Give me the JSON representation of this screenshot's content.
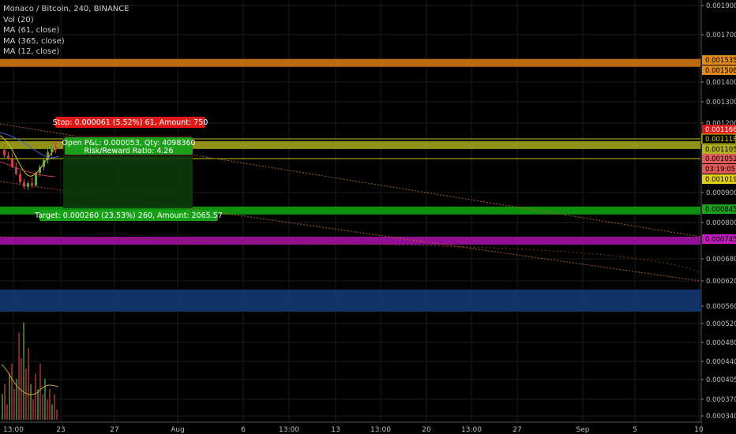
{
  "legend": {
    "symbol": "Monaco / Bitcoin, 240, BINANCE",
    "vol": "Vol (20)",
    "ma61": "MA (61, close)",
    "ma365": "MA (365, close)",
    "ma12": "MA (12, close)"
  },
  "colors": {
    "background": "#000000",
    "grid": "#1c1c1c",
    "orange_zone": "#c8700f",
    "yellow_zone": "#9a9a1a",
    "green_zone": "#0f9a0f",
    "purple_zone": "#9a0f9a",
    "blue_zone": "#12366e",
    "trend_line": "#b05a2a",
    "stop_label": "#e01818",
    "target_label": "#18a018",
    "position_label": "#1ca01c",
    "candle_up": "#5c9e4a",
    "candle_down": "#c24141",
    "volume_up": "#3d6e32",
    "volume_down": "#7a2a2a",
    "ma_yellow": "#d6c21c",
    "ma_blue": "#4466cc",
    "ma_red": "#cc3344",
    "vol_ma": "#c8a040"
  },
  "position_tool": {
    "stop_text": "Stop: 0.000061 (5.52%) 61, Amount: 750",
    "pnl_text": "Open P&L: 0.000053, Qty: 4098360",
    "rr_text": "Risk/Reward Ratio: 4.26",
    "target_text": "Target: 0.000260 (23.53%) 260, Amount: 2065.57"
  },
  "chart_data": {
    "type": "candlestick",
    "title": "Monaco / Bitcoin, 240, BINANCE",
    "y_axis": {
      "ticks": [
        "0.001900",
        "0.001700",
        "0.001400",
        "0.001300",
        "0.001200",
        "0.000900",
        "0.000800",
        "0.000680",
        "0.000620",
        "0.000560",
        "0.000520",
        "0.000480",
        "0.000440",
        "0.000405",
        "0.000370",
        "0.000340"
      ]
    },
    "price_badges": [
      {
        "text": "0.001535",
        "color": "#e08a1c",
        "text_color": "#000"
      },
      {
        "text": "0.001508",
        "color": "#e08a1c",
        "text_color": "#000"
      },
      {
        "text": "0.001166",
        "color": "#e01818",
        "text_color": "#fff"
      },
      {
        "text": "0.001118",
        "color": "#000000",
        "text_color": "#d6d600",
        "border": "#d6d600"
      },
      {
        "text": "0.001105",
        "color": "#b0b020",
        "text_color": "#000"
      },
      {
        "text": "0.001052",
        "color": "#e05a5a",
        "text_color": "#000"
      },
      {
        "text": "03:19:05",
        "color": "#e05a5a",
        "text_color": "#000"
      },
      {
        "text": "0.001019",
        "color": "#e0d01c",
        "text_color": "#000"
      },
      {
        "text": "0.000845",
        "color": "#1ca01c",
        "text_color": "#000"
      },
      {
        "text": "0.000745",
        "color": "#c01cc0",
        "text_color": "#000"
      }
    ],
    "x_axis": {
      "ticks": [
        "13:00",
        "23",
        "27",
        "Aug",
        "6",
        "13:00",
        "13",
        "13:00",
        "20",
        "13:00",
        "27",
        "Sep",
        "5",
        "10"
      ]
    },
    "zones": [
      {
        "name": "resistance-orange",
        "low": 0.001508,
        "high": 0.001535
      },
      {
        "name": "entry-yellow",
        "low": 0.001092,
        "high": 0.001118
      },
      {
        "name": "target-green",
        "low": 0.000835,
        "high": 0.000845
      },
      {
        "name": "support-purple",
        "low": 0.000735,
        "high": 0.000745
      },
      {
        "name": "support-blue",
        "low": 0.000547,
        "high": 0.0006
      }
    ],
    "candles": [
      {
        "o": 0.001085,
        "h": 0.00111,
        "l": 0.00105,
        "c": 0.00106
      },
      {
        "o": 0.00106,
        "h": 0.001075,
        "l": 0.00104,
        "c": 0.001045
      },
      {
        "o": 0.001045,
        "h": 0.00107,
        "l": 0.001005,
        "c": 0.00101
      },
      {
        "o": 0.00101,
        "h": 0.00103,
        "l": 0.000975,
        "c": 0.00098
      },
      {
        "o": 0.00098,
        "h": 0.000995,
        "l": 0.000935,
        "c": 0.000945
      },
      {
        "o": 0.000945,
        "h": 0.00096,
        "l": 0.000915,
        "c": 0.000925
      },
      {
        "o": 0.000925,
        "h": 0.00095,
        "l": 0.00091,
        "c": 0.00094
      },
      {
        "o": 0.00094,
        "h": 0.000965,
        "l": 0.00092,
        "c": 0.00093
      },
      {
        "o": 0.00093,
        "h": 0.00099,
        "l": 0.000925,
        "c": 0.000985
      },
      {
        "o": 0.000985,
        "h": 0.00102,
        "l": 0.00097,
        "c": 0.00101
      },
      {
        "o": 0.00101,
        "h": 0.00105,
        "l": 0.000995,
        "c": 0.00104
      },
      {
        "o": 0.00104,
        "h": 0.001095,
        "l": 0.001025,
        "c": 0.001075
      },
      {
        "o": 0.001075,
        "h": 0.00112,
        "l": 0.001055,
        "c": 0.0011
      },
      {
        "o": 0.0011,
        "h": 0.001125,
        "l": 0.00107,
        "c": 0.001085
      }
    ],
    "volumes": [
      0.25,
      0.35,
      0.15,
      0.45,
      0.55,
      0.3,
      0.4,
      0.85,
      0.6,
      0.95,
      0.5,
      0.7,
      0.35,
      0.2,
      0.45,
      0.3,
      0.55,
      0.25,
      0.4,
      0.2,
      0.3,
      0.15,
      0.25,
      0.1
    ]
  }
}
